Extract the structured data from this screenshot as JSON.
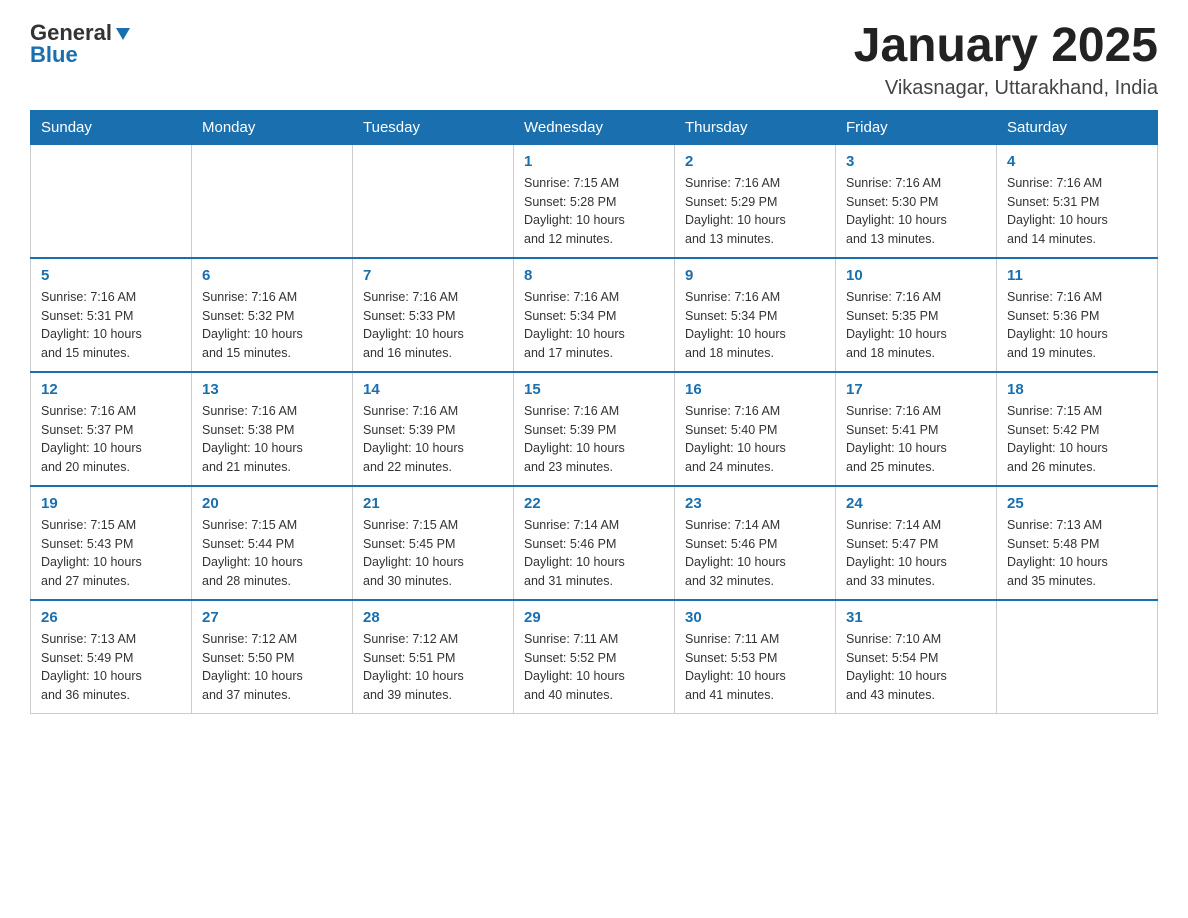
{
  "logo": {
    "general": "General",
    "blue": "Blue"
  },
  "header": {
    "title": "January 2025",
    "subtitle": "Vikasnagar, Uttarakhand, India"
  },
  "weekdays": [
    "Sunday",
    "Monday",
    "Tuesday",
    "Wednesday",
    "Thursday",
    "Friday",
    "Saturday"
  ],
  "weeks": [
    [
      {
        "day": "",
        "info": ""
      },
      {
        "day": "",
        "info": ""
      },
      {
        "day": "",
        "info": ""
      },
      {
        "day": "1",
        "info": "Sunrise: 7:15 AM\nSunset: 5:28 PM\nDaylight: 10 hours\nand 12 minutes."
      },
      {
        "day": "2",
        "info": "Sunrise: 7:16 AM\nSunset: 5:29 PM\nDaylight: 10 hours\nand 13 minutes."
      },
      {
        "day": "3",
        "info": "Sunrise: 7:16 AM\nSunset: 5:30 PM\nDaylight: 10 hours\nand 13 minutes."
      },
      {
        "day": "4",
        "info": "Sunrise: 7:16 AM\nSunset: 5:31 PM\nDaylight: 10 hours\nand 14 minutes."
      }
    ],
    [
      {
        "day": "5",
        "info": "Sunrise: 7:16 AM\nSunset: 5:31 PM\nDaylight: 10 hours\nand 15 minutes."
      },
      {
        "day": "6",
        "info": "Sunrise: 7:16 AM\nSunset: 5:32 PM\nDaylight: 10 hours\nand 15 minutes."
      },
      {
        "day": "7",
        "info": "Sunrise: 7:16 AM\nSunset: 5:33 PM\nDaylight: 10 hours\nand 16 minutes."
      },
      {
        "day": "8",
        "info": "Sunrise: 7:16 AM\nSunset: 5:34 PM\nDaylight: 10 hours\nand 17 minutes."
      },
      {
        "day": "9",
        "info": "Sunrise: 7:16 AM\nSunset: 5:34 PM\nDaylight: 10 hours\nand 18 minutes."
      },
      {
        "day": "10",
        "info": "Sunrise: 7:16 AM\nSunset: 5:35 PM\nDaylight: 10 hours\nand 18 minutes."
      },
      {
        "day": "11",
        "info": "Sunrise: 7:16 AM\nSunset: 5:36 PM\nDaylight: 10 hours\nand 19 minutes."
      }
    ],
    [
      {
        "day": "12",
        "info": "Sunrise: 7:16 AM\nSunset: 5:37 PM\nDaylight: 10 hours\nand 20 minutes."
      },
      {
        "day": "13",
        "info": "Sunrise: 7:16 AM\nSunset: 5:38 PM\nDaylight: 10 hours\nand 21 minutes."
      },
      {
        "day": "14",
        "info": "Sunrise: 7:16 AM\nSunset: 5:39 PM\nDaylight: 10 hours\nand 22 minutes."
      },
      {
        "day": "15",
        "info": "Sunrise: 7:16 AM\nSunset: 5:39 PM\nDaylight: 10 hours\nand 23 minutes."
      },
      {
        "day": "16",
        "info": "Sunrise: 7:16 AM\nSunset: 5:40 PM\nDaylight: 10 hours\nand 24 minutes."
      },
      {
        "day": "17",
        "info": "Sunrise: 7:16 AM\nSunset: 5:41 PM\nDaylight: 10 hours\nand 25 minutes."
      },
      {
        "day": "18",
        "info": "Sunrise: 7:15 AM\nSunset: 5:42 PM\nDaylight: 10 hours\nand 26 minutes."
      }
    ],
    [
      {
        "day": "19",
        "info": "Sunrise: 7:15 AM\nSunset: 5:43 PM\nDaylight: 10 hours\nand 27 minutes."
      },
      {
        "day": "20",
        "info": "Sunrise: 7:15 AM\nSunset: 5:44 PM\nDaylight: 10 hours\nand 28 minutes."
      },
      {
        "day": "21",
        "info": "Sunrise: 7:15 AM\nSunset: 5:45 PM\nDaylight: 10 hours\nand 30 minutes."
      },
      {
        "day": "22",
        "info": "Sunrise: 7:14 AM\nSunset: 5:46 PM\nDaylight: 10 hours\nand 31 minutes."
      },
      {
        "day": "23",
        "info": "Sunrise: 7:14 AM\nSunset: 5:46 PM\nDaylight: 10 hours\nand 32 minutes."
      },
      {
        "day": "24",
        "info": "Sunrise: 7:14 AM\nSunset: 5:47 PM\nDaylight: 10 hours\nand 33 minutes."
      },
      {
        "day": "25",
        "info": "Sunrise: 7:13 AM\nSunset: 5:48 PM\nDaylight: 10 hours\nand 35 minutes."
      }
    ],
    [
      {
        "day": "26",
        "info": "Sunrise: 7:13 AM\nSunset: 5:49 PM\nDaylight: 10 hours\nand 36 minutes."
      },
      {
        "day": "27",
        "info": "Sunrise: 7:12 AM\nSunset: 5:50 PM\nDaylight: 10 hours\nand 37 minutes."
      },
      {
        "day": "28",
        "info": "Sunrise: 7:12 AM\nSunset: 5:51 PM\nDaylight: 10 hours\nand 39 minutes."
      },
      {
        "day": "29",
        "info": "Sunrise: 7:11 AM\nSunset: 5:52 PM\nDaylight: 10 hours\nand 40 minutes."
      },
      {
        "day": "30",
        "info": "Sunrise: 7:11 AM\nSunset: 5:53 PM\nDaylight: 10 hours\nand 41 minutes."
      },
      {
        "day": "31",
        "info": "Sunrise: 7:10 AM\nSunset: 5:54 PM\nDaylight: 10 hours\nand 43 minutes."
      },
      {
        "day": "",
        "info": ""
      }
    ]
  ]
}
